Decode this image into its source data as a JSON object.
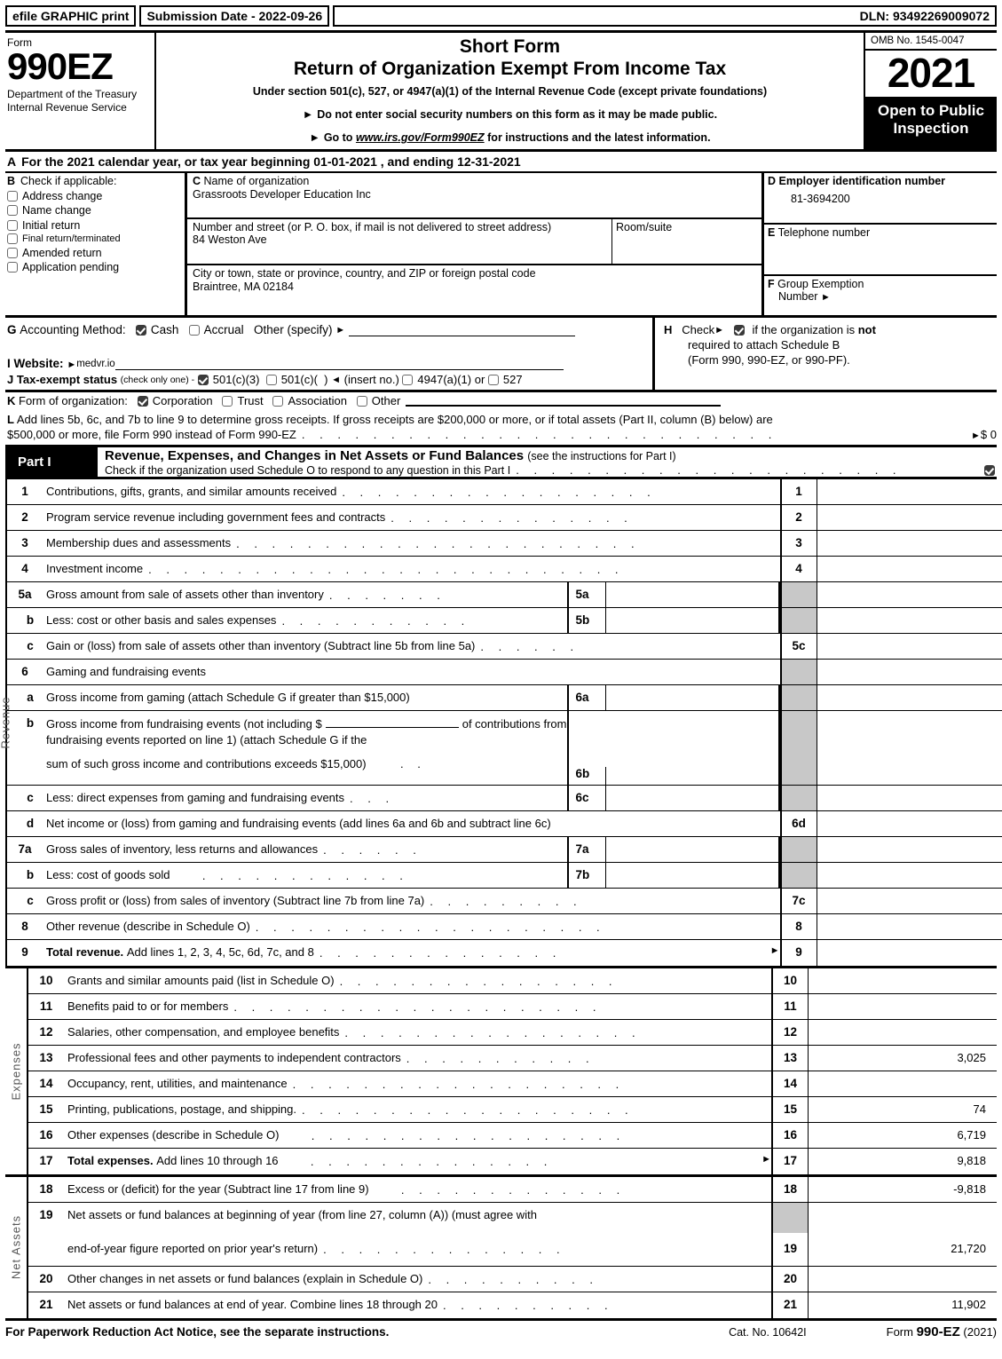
{
  "topbar": {
    "efile_label": "efile GRAPHIC print",
    "submission_label": "Submission Date - 2022-09-26",
    "dln_label": "DLN: 93492269009072"
  },
  "masthead": {
    "form_word": "Form",
    "form_number": "990EZ",
    "department": "Department of the Treasury Internal Revenue Service",
    "title_line1": "Short Form",
    "title_line2": "Return of Organization Exempt From Income Tax",
    "subtitle": "Under section 501(c), 527, or 4947(a)(1) of the Internal Revenue Code (except private foundations)",
    "bullet1": "Do not enter social security numbers on this form as it may be made public.",
    "bullet2_pre": "Go to",
    "bullet2_link": "www.irs.gov/Form990EZ",
    "bullet2_post": "for instructions and the latest information.",
    "omb": "OMB No. 1545-0047",
    "year": "2021",
    "open_to_public": "Open to Public Inspection"
  },
  "lineA": {
    "letter": "A",
    "text": "For the 2021 calendar year, or tax year beginning 01-01-2021 , and ending 12-31-2021"
  },
  "sectionB": {
    "letter": "B",
    "heading": "Check if applicable:",
    "items": [
      {
        "label": "Address change",
        "checked": false
      },
      {
        "label": "Name change",
        "checked": false
      },
      {
        "label": "Initial return",
        "checked": false
      },
      {
        "label": "Final return/terminated",
        "checked": false
      },
      {
        "label": "Amended return",
        "checked": false
      },
      {
        "label": "Application pending",
        "checked": false
      }
    ]
  },
  "sectionC": {
    "letter": "C",
    "name_label": "Name of organization",
    "name_value": "Grassroots Developer Education Inc",
    "street_label": "Number and street (or P. O. box, if mail is not delivered to street address)",
    "street_value": "84 Weston Ave",
    "room_label": "Room/suite",
    "room_value": "",
    "city_label": "City or town, state or province, country, and ZIP or foreign postal code",
    "city_value": "Braintree, MA   02184"
  },
  "sectionD": {
    "letter": "D",
    "ein_label": "Employer identification number",
    "ein_value": "81-3694200",
    "phone_letter": "E",
    "phone_label": "Telephone number",
    "phone_value": "",
    "group_letter": "F",
    "group_label_line1": "Group Exemption",
    "group_label_line2": "Number"
  },
  "sectionG": {
    "letter": "G",
    "label": "Accounting Method:",
    "cash": {
      "label": "Cash",
      "checked": true
    },
    "accrual": {
      "label": "Accrual",
      "checked": false
    },
    "other_label": "Other (specify)"
  },
  "sectionH": {
    "letter": "H",
    "check_label": "Check",
    "checked": true,
    "text_line1_a": "if the organization is",
    "text_line1_b": "not",
    "text_line2": "required to attach Schedule B",
    "text_line3": "(Form 990, 990-EZ, or 990-PF)."
  },
  "sectionI": {
    "letter": "I",
    "label": "Website:",
    "value": "medvr.io"
  },
  "sectionJ": {
    "letter": "J",
    "label": "Tax-exempt status",
    "note": "(check only one) -",
    "opt1": {
      "label": "501(c)(3)",
      "checked": true
    },
    "opt2": {
      "label": "501(c)(",
      "suffix": ")",
      "checked": false
    },
    "insert": "(insert no.)",
    "opt3": {
      "label": "4947(a)(1)",
      "checked": false
    },
    "or": "or",
    "opt4": {
      "label": "527",
      "checked": false
    }
  },
  "sectionK": {
    "letter": "K",
    "label": "Form of organization:",
    "options": [
      {
        "label": "Corporation",
        "checked": true
      },
      {
        "label": "Trust",
        "checked": false
      },
      {
        "label": "Association",
        "checked": false
      },
      {
        "label": "Other",
        "checked": false
      }
    ]
  },
  "sectionL": {
    "letter": "L",
    "line1": "Add lines 5b, 6c, and 7b to line 9 to determine gross receipts. If gross receipts are $200,000 or more, or if total assets (Part II, column (B) below) are",
    "line2": "$500,000 or more, file Form 990 instead of Form 990-EZ",
    "value": "$ 0"
  },
  "partI": {
    "tag": "Part I",
    "title": "Revenue, Expenses, and Changes in Net Assets or Fund Balances",
    "title_sub": "(see the instructions for Part I)",
    "schedule_o_text": "Check if the organization used Schedule O to respond to any question in this Part I",
    "schedule_o_checked": true
  },
  "revenue": {
    "rail_label": "Revenue",
    "rows": [
      {
        "num": "1",
        "desc": "Contributions, gifts, grants, and similar amounts received",
        "lncol": "1",
        "amount": "",
        "shade": false,
        "sub": null
      },
      {
        "num": "2",
        "desc": "Program service revenue including government fees and contracts",
        "lncol": "2",
        "amount": "",
        "shade": false,
        "sub": null
      },
      {
        "num": "3",
        "desc": "Membership dues and assessments",
        "lncol": "3",
        "amount": "",
        "shade": false,
        "sub": null
      },
      {
        "num": "4",
        "desc": "Investment income",
        "lncol": "4",
        "amount": "",
        "shade": false,
        "sub": null
      },
      {
        "num": "5a",
        "desc": "Gross amount from sale of assets other than inventory",
        "lncol": "",
        "amount": "",
        "shade": true,
        "sub": {
          "label": "5a",
          "value": ""
        }
      },
      {
        "num": "b",
        "desc": "Less: cost or other basis and sales expenses",
        "lncol": "",
        "amount": "",
        "shade": true,
        "sub": {
          "label": "5b",
          "value": ""
        }
      },
      {
        "num": "c",
        "desc": "Gain or (loss) from sale of assets other than inventory (Subtract line 5b from line 5a)",
        "lncol": "5c",
        "amount": "",
        "shade": false,
        "sub": null
      },
      {
        "num": "6",
        "desc": "Gaming and fundraising events",
        "lncol": "",
        "amount": "",
        "shade": true,
        "sub": null
      },
      {
        "num": "a",
        "desc": "Gross income from gaming (attach Schedule G if greater than $15,000)",
        "lncol": "",
        "amount": "",
        "shade": true,
        "sub": {
          "label": "6a",
          "value": ""
        }
      },
      {
        "num": "c",
        "desc": "Less: direct expenses from gaming and fundraising events",
        "lncol": "",
        "amount": "",
        "shade": true,
        "sub": {
          "label": "6c",
          "value": ""
        }
      },
      {
        "num": "d",
        "desc": "Net income or (loss) from gaming and fundraising events (add lines 6a and 6b and subtract line 6c)",
        "lncol": "6d",
        "amount": "",
        "shade": false,
        "sub": null
      },
      {
        "num": "7a",
        "desc": "Gross sales of inventory, less returns and allowances",
        "lncol": "",
        "amount": "",
        "shade": true,
        "sub": {
          "label": "7a",
          "value": ""
        }
      },
      {
        "num": "b",
        "desc": "Less: cost of goods sold",
        "lncol": "",
        "amount": "",
        "shade": true,
        "sub": {
          "label": "7b",
          "value": ""
        }
      },
      {
        "num": "c",
        "desc": "Gross profit or (loss) from sales of inventory (Subtract line 7b from line 7a)",
        "lncol": "7c",
        "amount": "",
        "shade": false,
        "sub": null
      },
      {
        "num": "8",
        "desc": "Other revenue (describe in Schedule O)",
        "lncol": "8",
        "amount": "",
        "shade": false,
        "sub": null
      },
      {
        "num": "9",
        "desc_bold": "Total revenue.",
        "desc": "Add lines 1, 2, 3, 4, 5c, 6d, 7c, and 8",
        "lncol": "9",
        "amount": "",
        "shade": false,
        "sub": null
      }
    ],
    "line6b": {
      "num": "b",
      "l1_pre": "Gross income from fundraising events (not including $",
      "l1_post": "of contributions from",
      "l2": "fundraising events reported on line 1) (attach Schedule G if the",
      "l3": "sum of such gross income and contributions exceeds $15,000)",
      "sub_label": "6b",
      "sub_value": ""
    }
  },
  "expenses": {
    "rail_label": "Expenses",
    "rows": [
      {
        "num": "10",
        "desc": "Grants and similar amounts paid (list in Schedule O)",
        "lncol": "10",
        "amount": ""
      },
      {
        "num": "11",
        "desc": "Benefits paid to or for members",
        "lncol": "11",
        "amount": ""
      },
      {
        "num": "12",
        "desc": "Salaries, other compensation, and employee benefits",
        "lncol": "12",
        "amount": ""
      },
      {
        "num": "13",
        "desc": "Professional fees and other payments to independent contractors",
        "lncol": "13",
        "amount": "3,025"
      },
      {
        "num": "14",
        "desc": "Occupancy, rent, utilities, and maintenance",
        "lncol": "14",
        "amount": ""
      },
      {
        "num": "15",
        "desc": "Printing, publications, postage, and shipping.",
        "lncol": "15",
        "amount": "74"
      },
      {
        "num": "16",
        "desc": "Other expenses (describe in Schedule O)",
        "lncol": "16",
        "amount": "6,719"
      },
      {
        "num": "17",
        "desc_bold": "Total expenses.",
        "desc": "Add lines 10 through 16",
        "lncol": "17",
        "amount": "9,818"
      }
    ]
  },
  "netassets": {
    "rail_label": "Net Assets",
    "rows": [
      {
        "num": "18",
        "desc": "Excess or (deficit) for the year (Subtract line 17 from line 9)",
        "lncol": "18",
        "amount": "-9,818"
      },
      {
        "num": "20",
        "desc": "Other changes in net assets or fund balances (explain in Schedule O)",
        "lncol": "20",
        "amount": ""
      },
      {
        "num": "21",
        "desc": "Net assets or fund balances at end of year. Combine lines 18 through 20",
        "lncol": "21",
        "amount": "11,902"
      }
    ],
    "line19": {
      "num": "19",
      "l1": "Net assets or fund balances at beginning of year (from line 27, column (A)) (must agree with",
      "l2": "end-of-year figure reported on prior year's return)",
      "lncol": "19",
      "amount": "21,720"
    }
  },
  "footer": {
    "notice": "For Paperwork Reduction Act Notice, see the separate instructions.",
    "cat": "Cat. No. 10642I",
    "form_pre": "Form",
    "form_name": "990-EZ",
    "form_year": "(2021)"
  }
}
